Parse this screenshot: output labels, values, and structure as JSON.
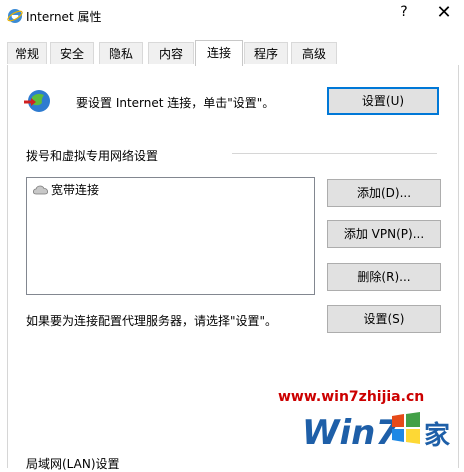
{
  "window": {
    "title": "Internet 属性",
    "help_glyph": "?",
    "close_glyph": "✕"
  },
  "tabs": [
    {
      "label": "常规"
    },
    {
      "label": "安全"
    },
    {
      "label": "隐私"
    },
    {
      "label": "内容"
    },
    {
      "label": "连接",
      "active": true
    },
    {
      "label": "程序"
    },
    {
      "label": "高级"
    }
  ],
  "setup": {
    "text": "要设置 Internet 连接，单击\"设置\"。",
    "button_label": "设置(U)"
  },
  "dialup": {
    "section_title": "拨号和虚拟专用网络设置",
    "connections": [
      {
        "name": "宽带连接"
      }
    ],
    "add_button": "添加(D)...",
    "add_vpn_button": "添加 VPN(P)...",
    "remove_button": "删除(R)...",
    "proxy_text": "如果要为连接配置代理服务器，请选择\"设置\"。",
    "settings_button": "设置(S)"
  },
  "lan": {
    "section_title": "局域网(LAN)设置"
  },
  "watermark": {
    "url": "www.win7zhijia.cn",
    "logo_text": "Win7",
    "logo_suffix": "家"
  },
  "colors": {
    "accent": "#0078d7",
    "watermark_red": "#cc0000",
    "logo_blue": "#1e5fa8"
  },
  "icons": {
    "title": "ie-icon",
    "setup": "globe-network-icon",
    "connection": "broadband-connection-icon"
  }
}
